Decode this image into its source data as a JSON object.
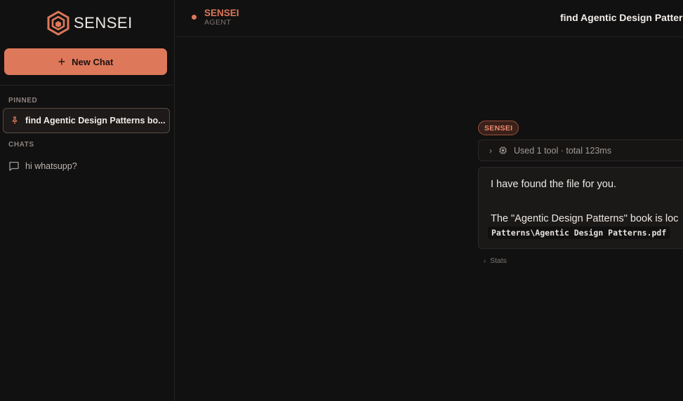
{
  "brand": {
    "name": "SENSEI",
    "accent_color": "#dd785a",
    "logo_icon": "hexagon-logo-icon"
  },
  "sidebar": {
    "new_chat_label": "New Chat",
    "new_chat_icon": "plus-icon",
    "pinned_label": "PINNED",
    "pinned_items": [
      {
        "label": "find Agentic Design Patterns bo...",
        "icon": "pin-icon"
      }
    ],
    "chats_label": "CHATS",
    "chat_items": [
      {
        "label": "hi whatsupp?",
        "icon": "chat-bubble-icon"
      }
    ]
  },
  "header": {
    "agent_name": "SENSEI",
    "agent_role": "AGENT",
    "title": "find Agentic Design Patterns"
  },
  "conversation": {
    "sender_badge": "SENSEI",
    "tool_summary": "Used 1 tool · total 123ms",
    "message_line_1": "I have found the file for you.",
    "message_line_2": "The \"Agentic Design Patterns\" book is loc",
    "message_code": "Patterns\\Agentic Design Patterns.pdf",
    "stats_label": "Stats"
  }
}
